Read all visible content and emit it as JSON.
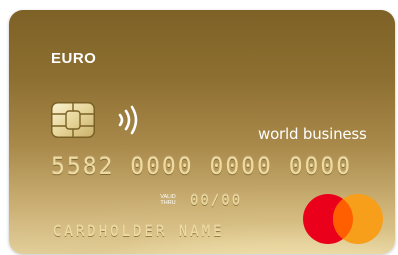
{
  "card": {
    "currency": "EURO",
    "brand_text": "world business",
    "number": "5582 0000 0000 0000",
    "valid_thru_line1": "VALID",
    "valid_thru_line2": "THRU",
    "expiry": "00/00",
    "holder": "CARDHOLDER NAME"
  },
  "icons": {
    "chip": "emv-chip-icon",
    "contactless": "contactless-icon",
    "network": "mastercard-logo"
  },
  "colors": {
    "card_gold_dark": "#7e6126",
    "card_gold_light": "#e2cf9b",
    "embossed_text": "#efdb9f",
    "mastercard_red": "#eb001b",
    "mastercard_orange": "#f79e1b",
    "mastercard_overlap": "#ff5f00"
  }
}
